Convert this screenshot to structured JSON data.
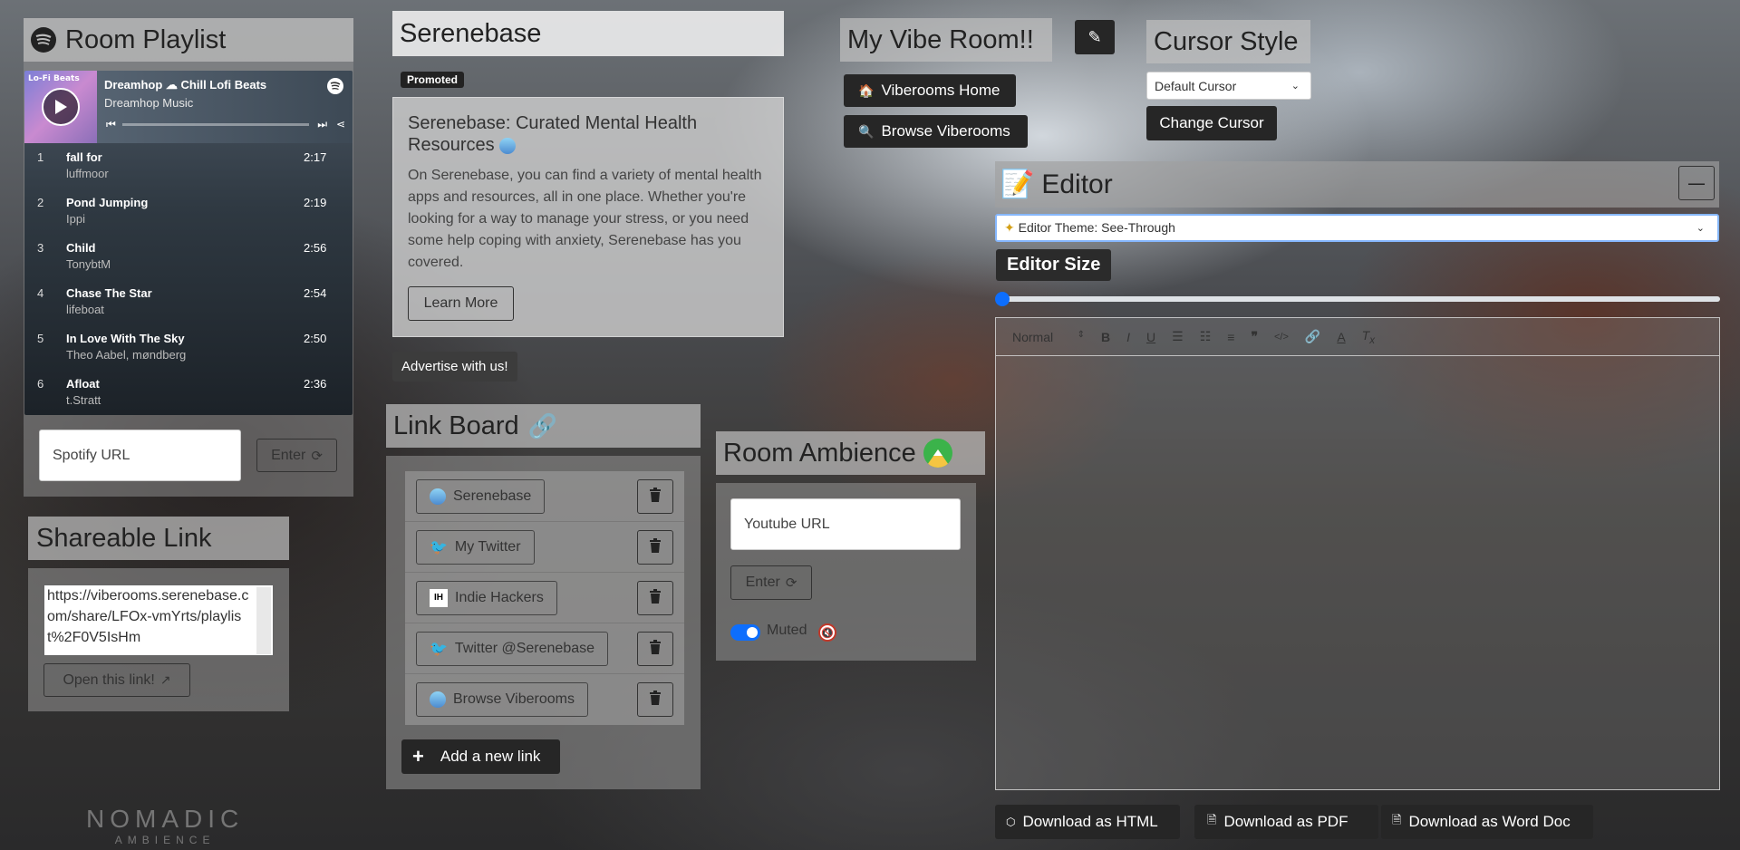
{
  "playlist": {
    "title": "Room Playlist",
    "now_playing": {
      "album_tag": "Lo-Fi Beats",
      "title": "Dreamhop ☁ Chill Lofi Beats",
      "artist": "Dreamhop Music"
    },
    "tracks": [
      {
        "num": "1",
        "title": "fall for",
        "artist": "luffmoor",
        "duration": "2:17"
      },
      {
        "num": "2",
        "title": "Pond Jumping",
        "artist": "Ippi",
        "duration": "2:19"
      },
      {
        "num": "3",
        "title": "Child",
        "artist": "TonybtM",
        "duration": "2:56"
      },
      {
        "num": "4",
        "title": "Chase The Star",
        "artist": "lifeboat",
        "duration": "2:54"
      },
      {
        "num": "5",
        "title": "In Love With The Sky",
        "artist": "Theo Aabel, møndberg",
        "duration": "2:50"
      },
      {
        "num": "6",
        "title": "Afloat",
        "artist": "t.Stratt",
        "duration": "2:36"
      }
    ],
    "url_placeholder": "Spotify URL",
    "enter_label": "Enter"
  },
  "shareable": {
    "title": "Shareable Link",
    "url": "https://viberooms.serenebase.com/share/LFOx-vmYrts/playlist%2F0V5IsHm",
    "open_label": "Open this link!"
  },
  "ad": {
    "site": "Serenebase",
    "badge": "Promoted",
    "headline": "Serenebase: Curated Mental Health Resources",
    "body": "On Serenebase, you can find a variety of mental health apps and resources, all in one place. Whether you're looking for a way to manage your stress, or you need some help coping with anxiety, Serenebase has you covered.",
    "cta": "Learn More",
    "advertise": "Advertise with us!"
  },
  "link_board": {
    "title": "Link Board",
    "links": [
      {
        "label": "Serenebase",
        "icon": "serenebase-icon"
      },
      {
        "label": "My Twitter",
        "icon": "twitter-icon"
      },
      {
        "label": "Indie Hackers",
        "icon": "indie-hackers-icon"
      },
      {
        "label": "Twitter @Serenebase",
        "icon": "twitter-icon"
      },
      {
        "label": "Browse Viberooms",
        "icon": "serenebase-icon"
      }
    ],
    "add_label": "Add a new link"
  },
  "room": {
    "title": "My Vibe Room!!",
    "home_label": "Viberooms Home",
    "browse_label": "Browse Viberooms"
  },
  "ambience": {
    "title": "Room Ambience",
    "url_placeholder": "Youtube URL",
    "enter_label": "Enter",
    "muted_label": "Muted",
    "muted": true
  },
  "cursor": {
    "title": "Cursor Style",
    "selected": "Default Cursor",
    "change_label": "Change Cursor"
  },
  "editor": {
    "title": "Editor",
    "theme": "Editor Theme: See-Through",
    "size_label": "Editor Size",
    "size_value": 0,
    "format": "Normal",
    "downloads": [
      "Download as HTML",
      "Download as PDF",
      "Download as Word Doc"
    ]
  },
  "watermark": {
    "line1": "NOMADIC",
    "line2": "AMBIENCE"
  },
  "colors": {
    "accent": "#0d6efd",
    "dark_button": "#262626",
    "spotify_green": "#1db954"
  }
}
